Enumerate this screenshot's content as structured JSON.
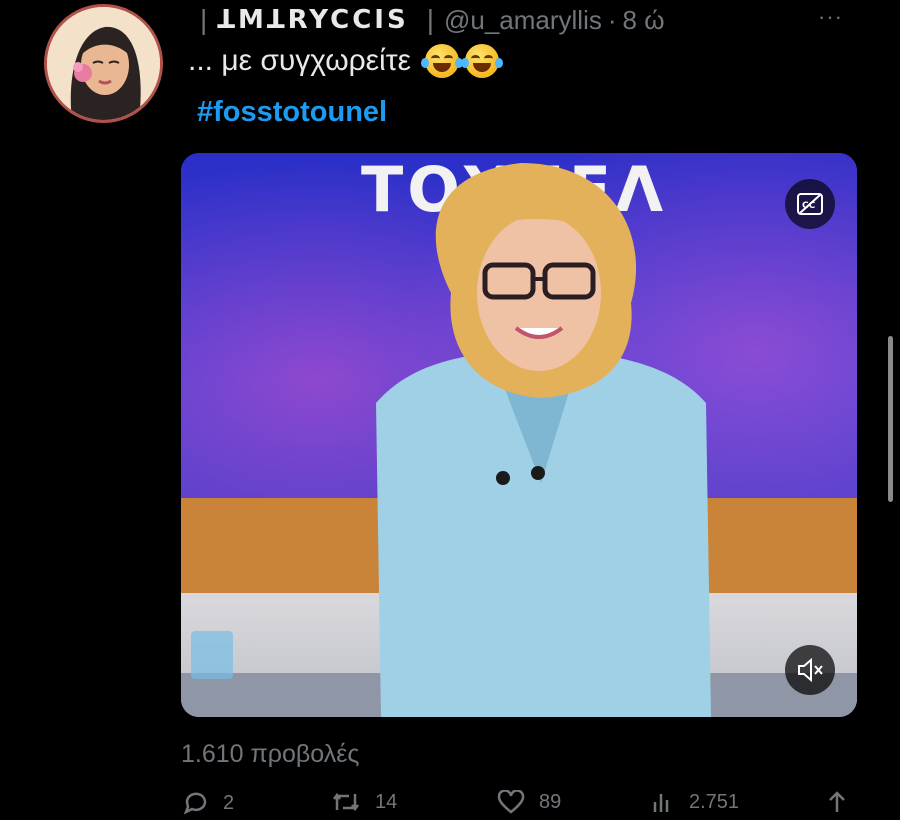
{
  "tweet": {
    "display_name": "ꓕMꓕRYCCIS",
    "handle": "@u_amaryllis",
    "separator_dot": "·",
    "time": "8 ώ",
    "more_label": "···",
    "text": "... με συγχωρείτε",
    "emojis": [
      "face-with-tears-of-joy",
      "face-with-tears-of-joy"
    ],
    "hashtag": "#fosstotounel"
  },
  "media": {
    "type": "video",
    "studio_logo_text": "ΤΟΥΝΕΛ",
    "cc_icon": "captions-icon",
    "mute_icon": "muted-speaker-icon"
  },
  "stats": {
    "views_label": "1.610 προβολές",
    "replies": "2",
    "retweets": "14",
    "likes": "89",
    "analytics": "2.751"
  },
  "colors": {
    "background": "#000000",
    "text": "#e7e9ea",
    "muted": "#71767b",
    "accent": "#1d9bf0"
  }
}
